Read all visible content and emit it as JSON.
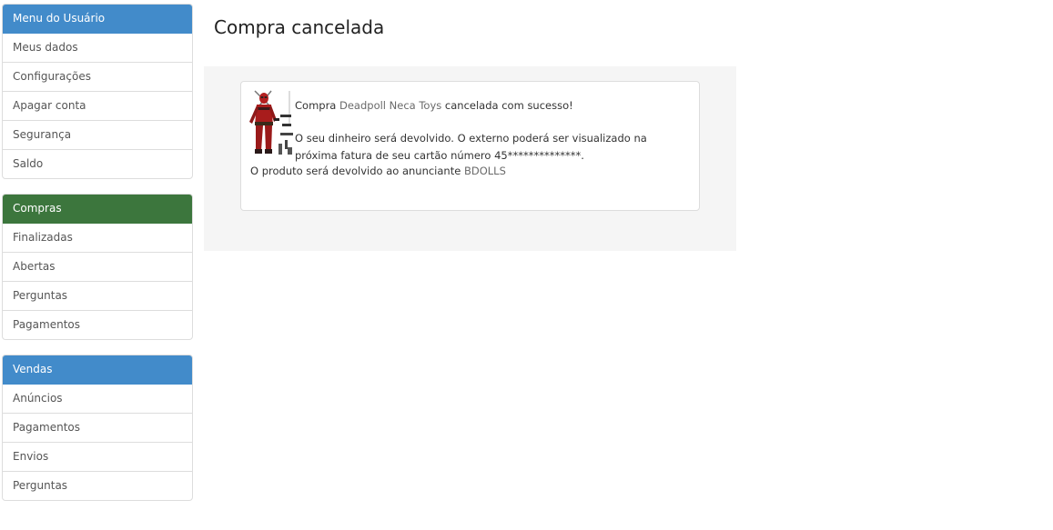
{
  "colors": {
    "blue_header": "#428bca",
    "green_header": "#3c763d",
    "well_bg": "#f5f5f5"
  },
  "sidebar": {
    "user_menu": {
      "title": "Menu do Usuário",
      "items": [
        {
          "label": "Meus dados"
        },
        {
          "label": "Configurações"
        },
        {
          "label": "Apagar conta"
        },
        {
          "label": "Segurança"
        },
        {
          "label": "Saldo"
        }
      ]
    },
    "purchases": {
      "title": "Compras",
      "items": [
        {
          "label": "Finalizadas"
        },
        {
          "label": "Abertas"
        },
        {
          "label": "Perguntas"
        },
        {
          "label": "Pagamentos"
        }
      ]
    },
    "sales": {
      "title": "Vendas",
      "items": [
        {
          "label": "Anúncios"
        },
        {
          "label": "Pagamentos"
        },
        {
          "label": "Envios"
        },
        {
          "label": "Perguntas"
        }
      ]
    }
  },
  "main": {
    "title": "Compra cancelada",
    "message": {
      "prefix": "Compra ",
      "product": "Deadpoll Neca Toys",
      "suffix": " cancelada com sucesso!",
      "refund": "O seu dinheiro será devolvido. O externo poderá ser visualizado na próxima fatura de seu cartão número 45**************.",
      "seller_prefix": "O produto será devolvido ao anunciante ",
      "seller": "BDOLLS"
    },
    "product_image_icon": "action-figure-image"
  }
}
